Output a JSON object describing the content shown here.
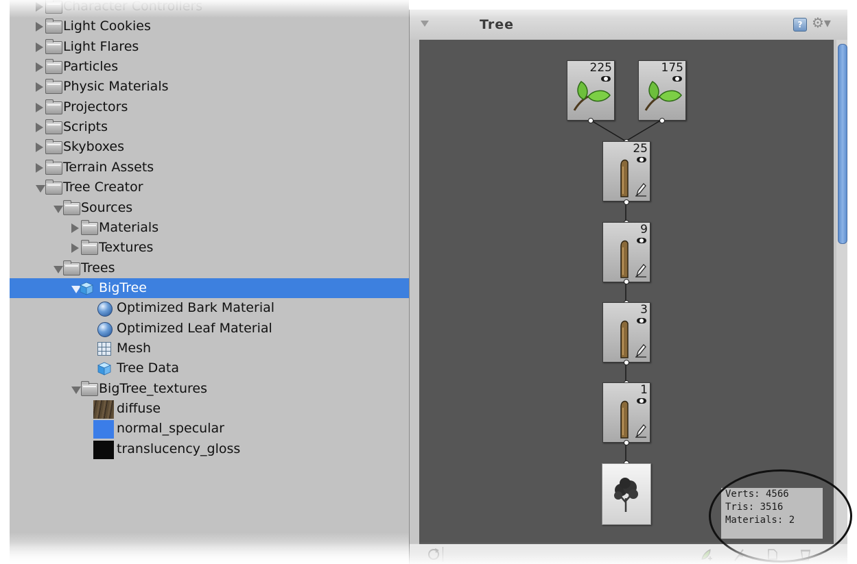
{
  "project": {
    "items": [
      {
        "label": "Character Controllers",
        "level": 0,
        "expanded": false,
        "icon": "folder"
      },
      {
        "label": "Light Cookies",
        "level": 0,
        "expanded": false,
        "icon": "folder"
      },
      {
        "label": "Light Flares",
        "level": 0,
        "expanded": false,
        "icon": "folder"
      },
      {
        "label": "Particles",
        "level": 0,
        "expanded": false,
        "icon": "folder"
      },
      {
        "label": "Physic Materials",
        "level": 0,
        "expanded": false,
        "icon": "folder"
      },
      {
        "label": "Projectors",
        "level": 0,
        "expanded": false,
        "icon": "folder"
      },
      {
        "label": "Scripts",
        "level": 0,
        "expanded": false,
        "icon": "folder"
      },
      {
        "label": "Skyboxes",
        "level": 0,
        "expanded": false,
        "icon": "folder"
      },
      {
        "label": "Terrain Assets",
        "level": 0,
        "expanded": false,
        "icon": "folder"
      },
      {
        "label": "Tree Creator",
        "level": 0,
        "expanded": true,
        "icon": "folder"
      },
      {
        "label": "Sources",
        "level": 1,
        "expanded": true,
        "icon": "folder"
      },
      {
        "label": "Materials",
        "level": 2,
        "expanded": false,
        "icon": "folder"
      },
      {
        "label": "Textures",
        "level": 2,
        "expanded": false,
        "icon": "folder"
      },
      {
        "label": "Trees",
        "level": 1,
        "expanded": true,
        "icon": "folder"
      },
      {
        "label": "BigTree",
        "level": 2,
        "expanded": true,
        "icon": "prefab-cube",
        "selected": true
      },
      {
        "label": "Optimized Bark Material",
        "level": 3,
        "icon": "material-sphere"
      },
      {
        "label": "Optimized Leaf Material",
        "level": 3,
        "icon": "material-sphere"
      },
      {
        "label": "Mesh",
        "level": 3,
        "icon": "mesh-grid"
      },
      {
        "label": "Tree Data",
        "level": 3,
        "icon": "cube"
      },
      {
        "label": "BigTree_textures",
        "level": 2,
        "expanded": true,
        "icon": "folder"
      },
      {
        "label": "diffuse",
        "level": 3,
        "icon": "texture-bark",
        "swatch": "#5b4a35"
      },
      {
        "label": "normal_specular",
        "level": 3,
        "icon": "texture-normal",
        "swatch": "#3b7de8"
      },
      {
        "label": "translucency_gloss",
        "level": 3,
        "icon": "texture-black",
        "swatch": "#0a0a0a"
      }
    ]
  },
  "tree_panel": {
    "title": "Tree",
    "help_icon_glyph": "?",
    "gear_icon_glyph": "⚙▾",
    "nodes": {
      "leaf_left_count": "225",
      "leaf_right_count": "175",
      "branch_1_count": "25",
      "branch_2_count": "9",
      "branch_3_count": "3",
      "branch_4_count": "1"
    },
    "stats": {
      "verts": "Verts: 4566",
      "tris": "Tris: 3516",
      "materials": "Materials: 2"
    }
  },
  "colors": {
    "selection": "#3d80df",
    "canvas": "#565656",
    "panel": "#c2c2c2"
  }
}
